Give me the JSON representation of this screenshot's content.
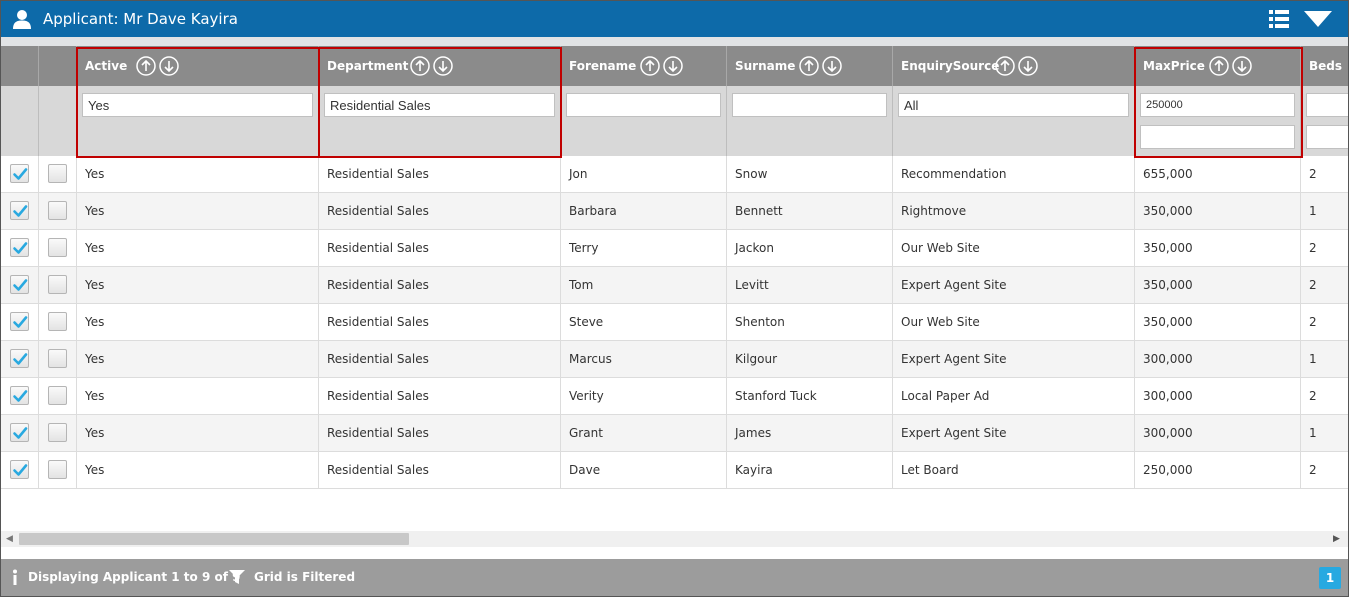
{
  "window": {
    "title": "Applicant: Mr Dave Kayira"
  },
  "columns": [
    {
      "label": "Active",
      "filter": "Yes",
      "placeholder": ""
    },
    {
      "label": "Department",
      "filter": "Residential Sales",
      "placeholder": ""
    },
    {
      "label": "Forename",
      "filter": "",
      "placeholder": ""
    },
    {
      "label": "Surname",
      "filter": "",
      "placeholder": ""
    },
    {
      "label": "EnquirySource",
      "filter": "All",
      "placeholder": ""
    },
    {
      "label": "MaxPrice",
      "filter": "250000",
      "filter2": "",
      "placeholder": ""
    },
    {
      "label": "Beds",
      "filter": "",
      "placeholder": ""
    }
  ],
  "rows": [
    {
      "checked": true,
      "active": "Yes",
      "department": "Residential Sales",
      "forename": "Jon",
      "surname": "Snow",
      "source": "Recommendation",
      "maxprice": "655,000",
      "beds": "2"
    },
    {
      "checked": true,
      "active": "Yes",
      "department": "Residential Sales",
      "forename": "Barbara",
      "surname": "Bennett",
      "source": "Rightmove",
      "maxprice": "350,000",
      "beds": "1"
    },
    {
      "checked": true,
      "active": "Yes",
      "department": "Residential Sales",
      "forename": "Terry",
      "surname": "Jackon",
      "source": "Our Web Site",
      "maxprice": "350,000",
      "beds": "2"
    },
    {
      "checked": true,
      "active": "Yes",
      "department": "Residential Sales",
      "forename": "Tom",
      "surname": "Levitt",
      "source": "Expert Agent Site",
      "maxprice": "350,000",
      "beds": "2"
    },
    {
      "checked": true,
      "active": "Yes",
      "department": "Residential Sales",
      "forename": "Steve",
      "surname": "Shenton",
      "source": "Our Web Site",
      "maxprice": "350,000",
      "beds": "2"
    },
    {
      "checked": true,
      "active": "Yes",
      "department": "Residential Sales",
      "forename": "Marcus",
      "surname": "Kilgour",
      "source": "Expert Agent Site",
      "maxprice": "300,000",
      "beds": "1"
    },
    {
      "checked": true,
      "active": "Yes",
      "department": "Residential Sales",
      "forename": "Verity",
      "surname": "Stanford Tuck",
      "source": "Local Paper Ad",
      "maxprice": "300,000",
      "beds": "2"
    },
    {
      "checked": true,
      "active": "Yes",
      "department": "Residential Sales",
      "forename": "Grant",
      "surname": "James",
      "source": "Expert Agent Site",
      "maxprice": "300,000",
      "beds": "1"
    },
    {
      "checked": true,
      "active": "Yes",
      "department": "Residential Sales",
      "forename": "Dave",
      "surname": "Kayira",
      "source": "Let Board",
      "maxprice": "250,000",
      "beds": "2"
    }
  ],
  "footer": {
    "status": "Displaying Applicant 1 to 9 of 9",
    "filter_status": "Grid is Filtered",
    "page": "1"
  },
  "colors": {
    "titlebar": "#0d6aa9",
    "header": "#8b8b8b",
    "highlight": "#c00000",
    "check": "#29a9e0",
    "page_button": "#27a9e1"
  },
  "icons": {
    "title": "user-icon",
    "grid": "list-view-icon",
    "dropdown": "dropdown-triangle-icon",
    "sort": [
      "sort-ascending-icon",
      "sort-descending-icon"
    ],
    "footer": [
      "info-icon",
      "filter-icon"
    ]
  }
}
